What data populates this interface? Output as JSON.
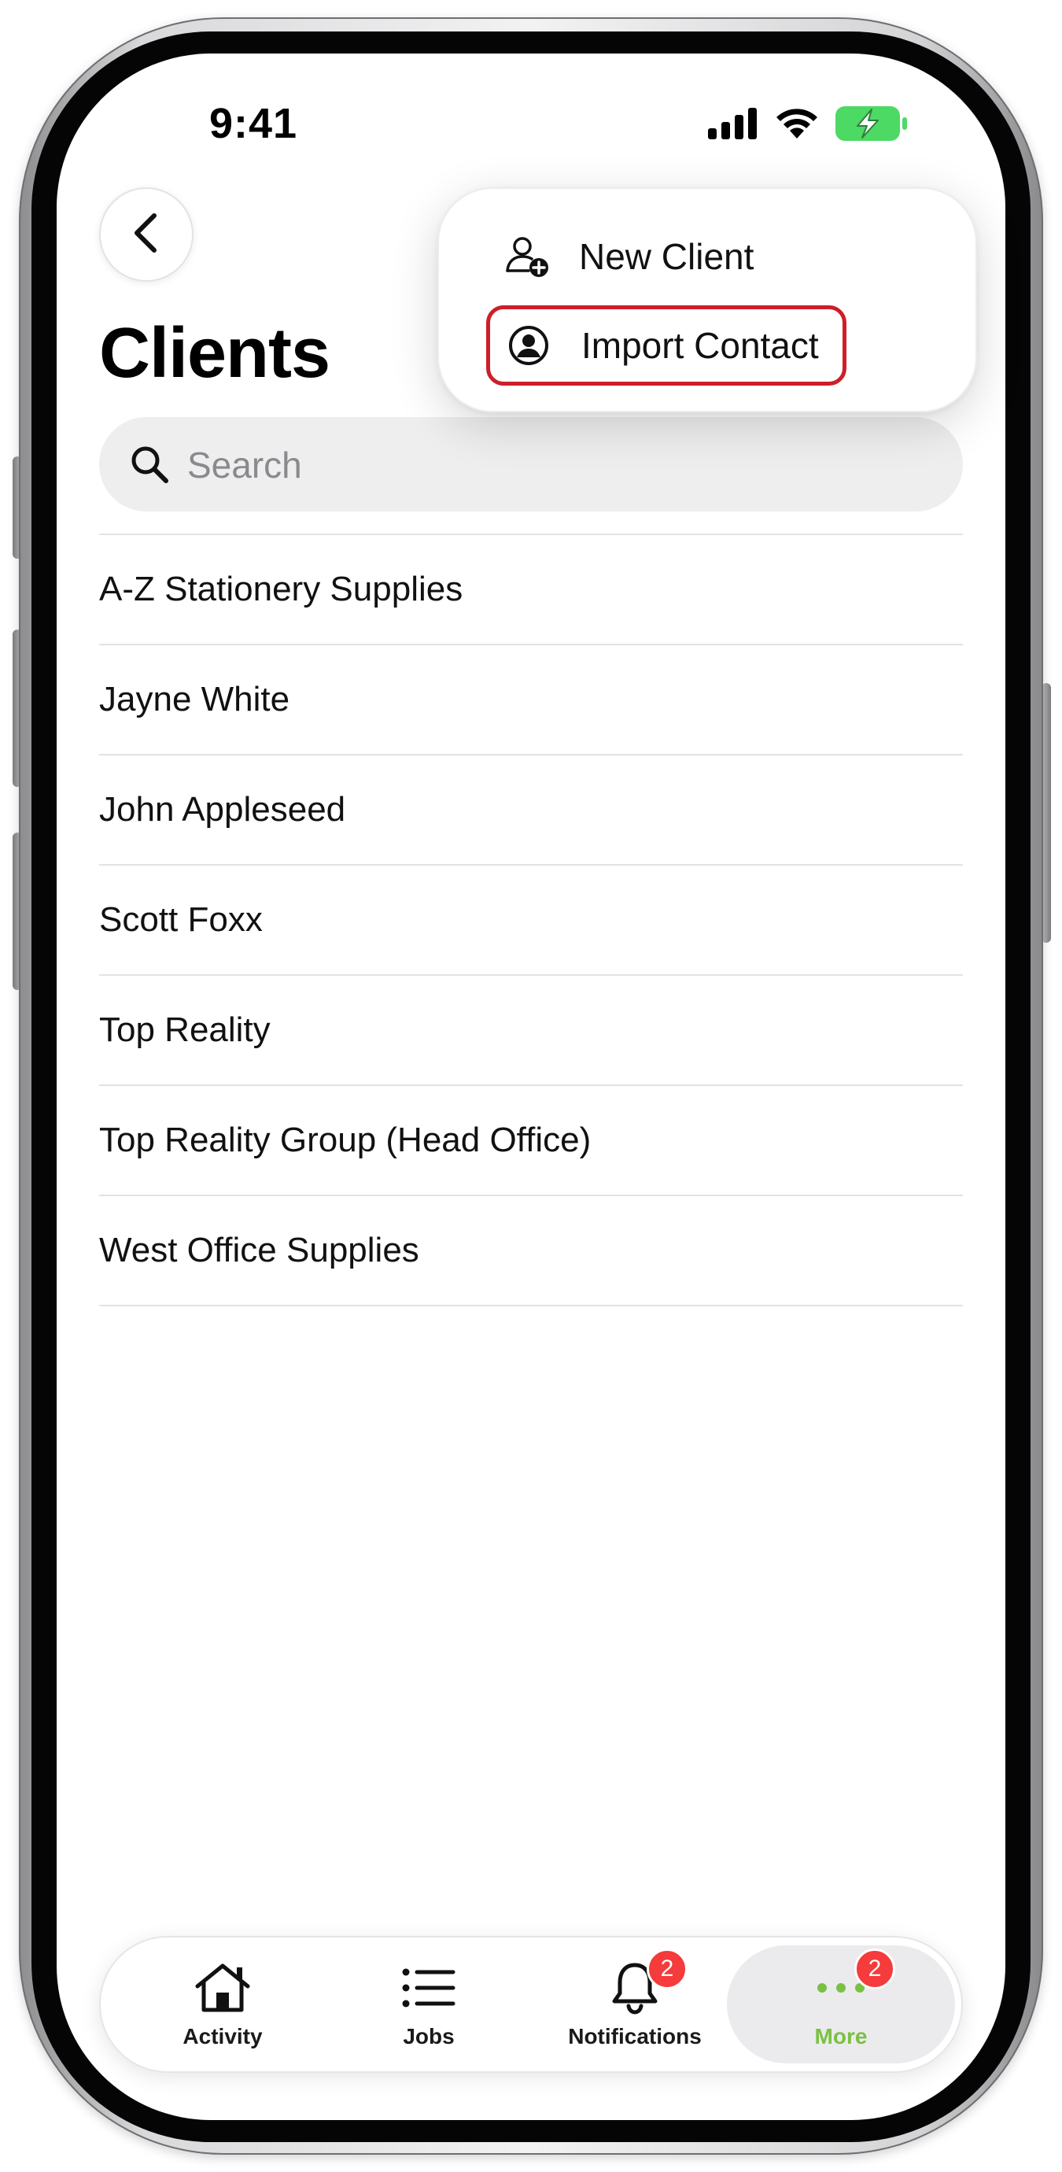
{
  "status_bar": {
    "time": "9:41",
    "signal_icon": "cellular-signal-icon",
    "wifi_icon": "wifi-icon",
    "battery_icon": "battery-charging-icon",
    "battery_color": "#4cd964"
  },
  "header": {
    "back_icon": "chevron-left-icon",
    "title": "Clients"
  },
  "search": {
    "placeholder": "Search",
    "value": "",
    "icon": "search-icon"
  },
  "clients": [
    "A-Z Stationery Supplies",
    "Jayne White",
    "John Appleseed",
    "Scott Foxx",
    "Top Reality",
    "Top Reality Group (Head Office)",
    "West Office Supplies"
  ],
  "menu": {
    "items": [
      {
        "label": "New Client",
        "icon": "person-add-icon"
      },
      {
        "label": "Import Contact",
        "icon": "person-circle-icon",
        "highlighted": true
      }
    ],
    "highlight_color": "#cc1f2a"
  },
  "tab_bar": {
    "tabs": [
      {
        "label": "Activity",
        "icon": "house-icon"
      },
      {
        "label": "Jobs",
        "icon": "list-icon"
      },
      {
        "label": "Notifications",
        "icon": "bell-icon",
        "badge": "2"
      },
      {
        "label": "More",
        "icon": "more-dots-icon",
        "badge": "2",
        "active": true
      }
    ],
    "accent_color": "#7bc043",
    "badge_color": "#f53b3b"
  }
}
